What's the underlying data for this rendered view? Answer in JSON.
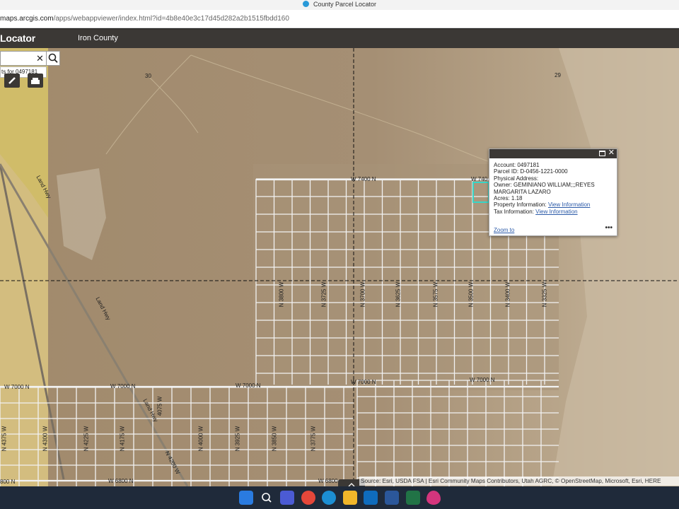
{
  "browser": {
    "tab_title": "County Parcel Locator",
    "url_host": "maps.arcgis.com",
    "url_path": "/apps/webappviewer/index.html?id=4b8e40e3c17d45d282a2b1515fbdd160"
  },
  "app": {
    "title": "Locator",
    "subtitle": "Iron County"
  },
  "search": {
    "value": "",
    "clear_label": "✕",
    "hint": "ts for 0497181"
  },
  "map": {
    "section_labels": [
      "30",
      "29"
    ],
    "road_labels": {
      "w7400_left": "W 7400 N",
      "w7400_right": "W 740",
      "w7000_a": "W 7000 N",
      "w7000_b": "W 7000 N",
      "w7000_c": "W 7000 N",
      "w7000_d": "W 7000 N",
      "w7000_e": "W 7000 N",
      "w6800_a": "W 6800 N",
      "w6800_b": "W 6800",
      "w6800_c": "800 N",
      "land_hwy_a": "Land Hwy",
      "land_hwy_b": "Land Hwy",
      "land_hwy_c": "Land Hwy",
      "n3800": "N 3800 W",
      "n3725": "N 3725 W",
      "n3700": "N 3700 W",
      "n3625": "N 3625 W",
      "n3575": "N 3575 W",
      "n3500": "N 3500 W",
      "n3400": "N 3400 W",
      "n3325": "N 3325 W",
      "n4375": "N 4375 W",
      "n4300": "N 4300 W",
      "n4225": "N 4225 W",
      "n4175": "N 4175 W",
      "n4075": "4075 W",
      "n4000": "N 4000 W",
      "n3925": "N 3925 W",
      "n3850": "N 3850 W",
      "n3775": "N 3775 W",
      "n4200": "N 4200 W"
    },
    "colors": {
      "land": "#a08a6e",
      "parcel_lines": "#f2f2f2",
      "section_lines": "#111111",
      "selection": "#37d6c8",
      "yellow_overlay": "#d8c468"
    }
  },
  "popup": {
    "account_label": "Account:",
    "account_value": "0497181",
    "parcel_label": "Parcel ID:",
    "parcel_value": "D-0456-1221-0000",
    "address_label": "Physical Address:",
    "owner_label": "Owner:",
    "owner_value": "GEMINIANO WILLIAM;;;REYES MARGARITA LAZARO",
    "acres_label": "Acres:",
    "acres_value": "1.18",
    "property_label": "Property Information:",
    "property_link": "View Information",
    "tax_label": "Tax Information:",
    "tax_link": "View Information",
    "zoom_link": "Zoom to",
    "more_label": "•••"
  },
  "attribution": "Source: Esri, USDA FSA | Esri Community Maps Contributors, Utah AGRC, © OpenStreetMap, Microsoft, Esri, HERE",
  "taskbar": {
    "icons": [
      "windows-start-icon",
      "search-icon",
      "zoom-icon",
      "chrome-icon",
      "edge-icon",
      "file-explorer-icon",
      "outlook-icon",
      "word-icon",
      "excel-icon",
      "drop-icon"
    ]
  }
}
